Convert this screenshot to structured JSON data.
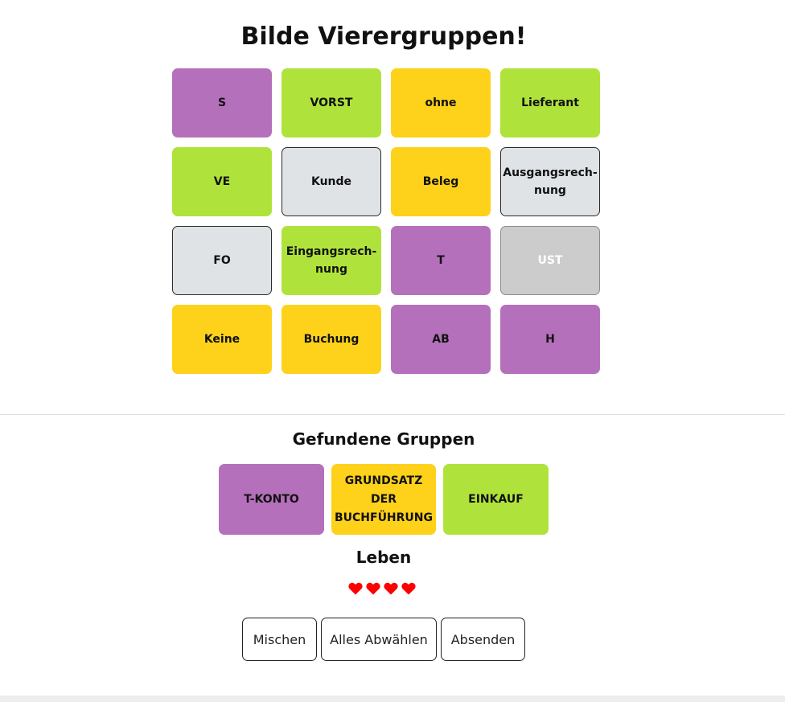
{
  "title": "Bilde Vierergruppen!",
  "tiles": [
    {
      "label": "S",
      "color": "purple"
    },
    {
      "label": "VORST",
      "color": "green"
    },
    {
      "label": "ohne",
      "color": "yellow"
    },
    {
      "label": "Lieferant",
      "color": "green"
    },
    {
      "label": "VE",
      "color": "green"
    },
    {
      "label": "Kunde",
      "color": "neutral"
    },
    {
      "label": "Beleg",
      "color": "yellow"
    },
    {
      "label": "Ausgangsrech-nung",
      "color": "neutral"
    },
    {
      "label": "FO",
      "color": "neutral"
    },
    {
      "label": "Eingangsrech-nung",
      "color": "green"
    },
    {
      "label": "T",
      "color": "purple"
    },
    {
      "label": "UST",
      "color": "disabled"
    },
    {
      "label": "Keine",
      "color": "yellow"
    },
    {
      "label": "Buchung",
      "color": "yellow"
    },
    {
      "label": "AB",
      "color": "purple"
    },
    {
      "label": "H",
      "color": "purple"
    }
  ],
  "found_groups": {
    "title": "Gefundene Gruppen",
    "groups": [
      {
        "label": "T-KONTO",
        "color": "purple"
      },
      {
        "label": "GRUNDSATZ DER BUCHFÜHRUNG",
        "color": "yellow"
      },
      {
        "label": "EINKAUF",
        "color": "green"
      }
    ]
  },
  "lives": {
    "title": "Leben",
    "count": 4,
    "icon": "heart-icon",
    "color": "#ff0000"
  },
  "buttons": {
    "shuffle": "Mischen",
    "deselect_all": "Alles Abwählen",
    "submit": "Absenden"
  },
  "colors": {
    "purple": "#b570bb",
    "green": "#afe33b",
    "yellow": "#fed11a",
    "neutral": "#e0e3e6",
    "disabled": "#cccccc"
  }
}
